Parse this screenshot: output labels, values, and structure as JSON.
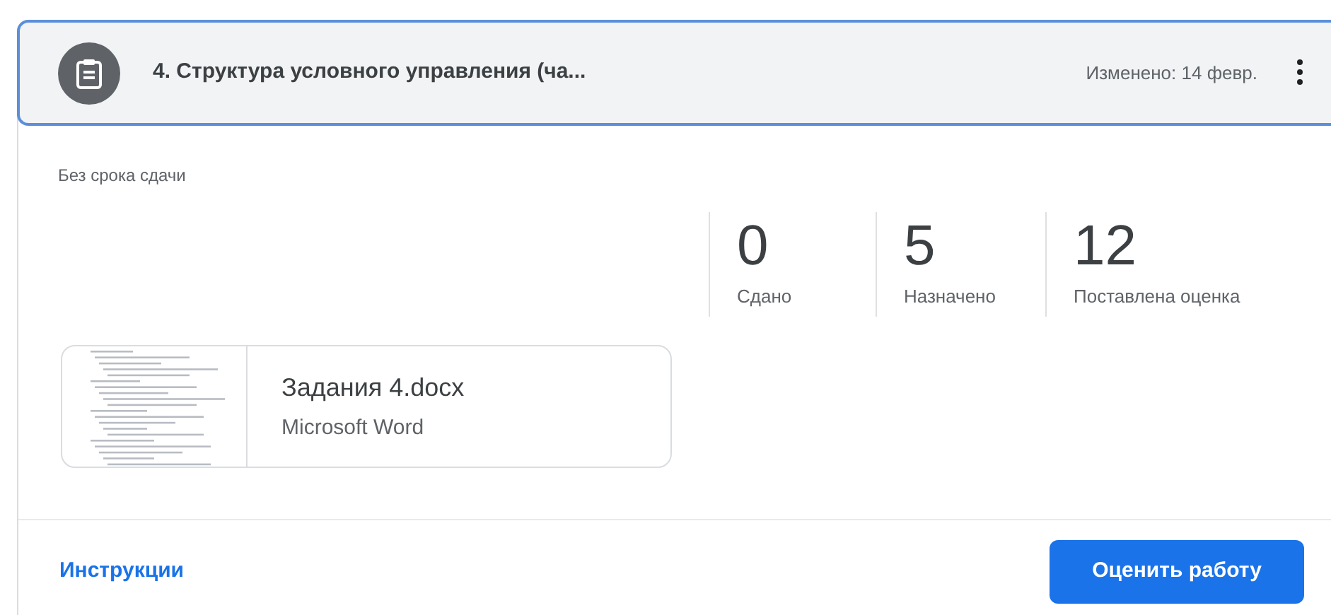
{
  "header": {
    "title": "4. Структура условного управления (ча...",
    "modified": "Изменено: 14 февр."
  },
  "due": "Без срока сдачи",
  "stats": [
    {
      "value": "0",
      "label": "Сдано"
    },
    {
      "value": "5",
      "label": "Назначено"
    },
    {
      "value": "12",
      "label": "Поставлена оценка"
    }
  ],
  "attachment": {
    "name": "Задания 4.docx",
    "type": "Microsoft Word"
  },
  "footer": {
    "link": "Инструкции",
    "button": "Оценить работу"
  }
}
